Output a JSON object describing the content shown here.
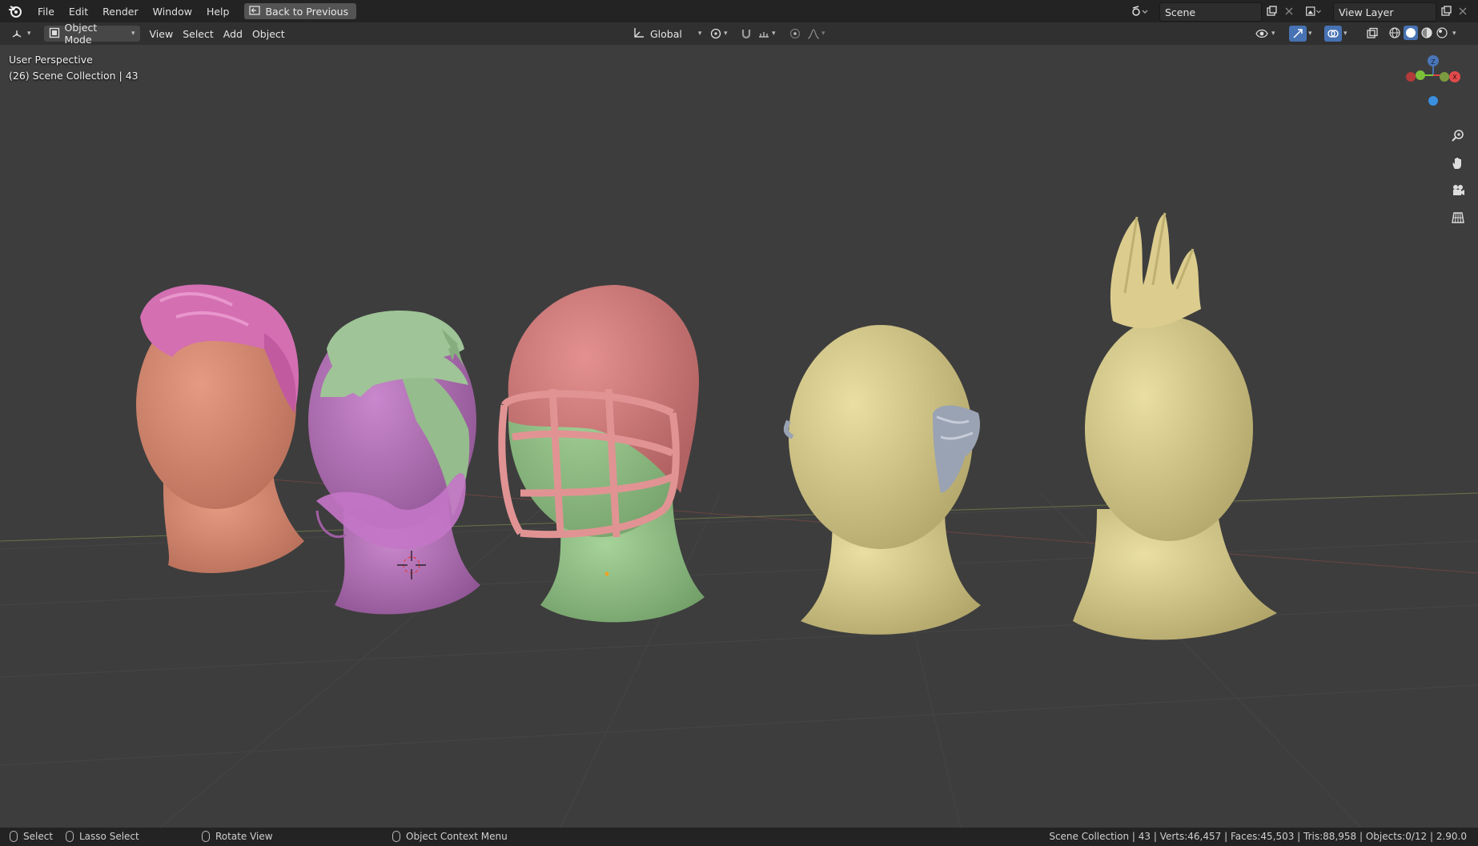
{
  "menu": {
    "file": "File",
    "edit": "Edit",
    "render": "Render",
    "window": "Window",
    "help": "Help",
    "back_to_previous": "Back to Previous"
  },
  "scene": {
    "name": "Scene"
  },
  "view_layer": {
    "name": "View Layer"
  },
  "header": {
    "mode": "Object Mode",
    "view": "View",
    "select": "Select",
    "add": "Add",
    "object": "Object",
    "transform_orientation": "Global"
  },
  "viewport": {
    "perspective_label": "User Perspective",
    "collection_label": "(26) Scene Collection | 43",
    "gizmo_z": "Z",
    "gizmo_x": "X"
  },
  "status": {
    "select": "Select",
    "lasso_select": "Lasso Select",
    "rotate_view": "Rotate View",
    "context_menu": "Object Context Menu",
    "stats": "Scene Collection | 43 | Verts:46,457 | Faces:45,503 | Tris:88,958 | Objects:0/12 | 2.90.0"
  },
  "colors": {
    "topbar": "#232323",
    "header": "#303030",
    "viewport": "#3d3d3d",
    "head_orange": "#d8886e",
    "head_pink_hair": "#d46fb2",
    "head_violet": "#b46fb8",
    "hair_green": "#9fc497",
    "helmet_red": "#d87b7b",
    "helmet_green": "#90bf84",
    "head_yellow": "#d8cc8a",
    "ear_gray": "#9aa3b4"
  },
  "icons": [
    "blender-logo-icon",
    "back-icon",
    "scene-icon",
    "new-scene-icon",
    "close-icon",
    "view-layer-icon",
    "editor-type-icon",
    "object-mode-icon",
    "orientation-icon",
    "pivot-icon",
    "snap-icon",
    "proportional-edit-icon",
    "visibility-icon",
    "gizmo-toggle-icon",
    "overlay-icon",
    "xray-icon",
    "wireframe-shading-icon",
    "solid-shading-icon",
    "material-shading-icon",
    "rendered-shading-icon",
    "zoom-icon",
    "hand-icon",
    "camera-icon",
    "grid-icon",
    "mouse-icon"
  ]
}
